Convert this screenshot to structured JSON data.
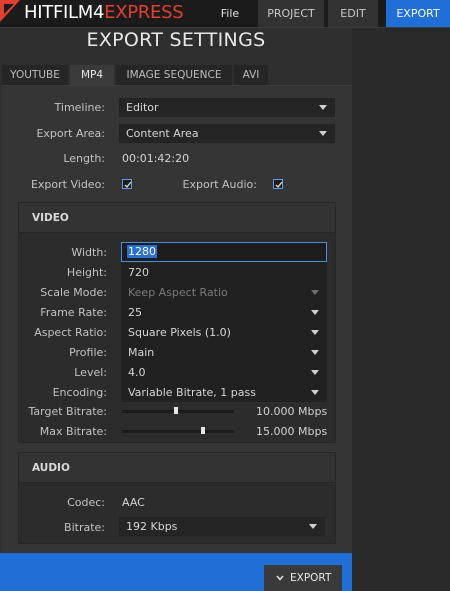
{
  "app": {
    "logo_main": "HITFILM4",
    "logo_accent": "EXPRESS",
    "brand_color": "#e0402d",
    "accent_color": "#1f6fd6"
  },
  "nav": {
    "file": "File",
    "project": "PROJECT",
    "edit": "EDIT",
    "export": "EXPORT",
    "active": "EXPORT"
  },
  "page": {
    "title": "EXPORT SETTINGS"
  },
  "tabs": [
    {
      "label": "YOUTUBE",
      "active": false
    },
    {
      "label": "MP4",
      "active": true
    },
    {
      "label": "IMAGE SEQUENCE",
      "active": false
    },
    {
      "label": "AVI",
      "active": false
    }
  ],
  "general": {
    "timeline_label": "Timeline:",
    "timeline_value": "Editor",
    "export_area_label": "Export Area:",
    "export_area_value": "Content Area",
    "length_label": "Length:",
    "length_value": "00:01:42:20",
    "export_video_label": "Export Video:",
    "export_video_checked": true,
    "export_audio_label": "Export Audio:",
    "export_audio_checked": true
  },
  "video": {
    "section_title": "VIDEO",
    "width_label": "Width:",
    "width_value": "1280",
    "height_label": "Height:",
    "height_value": "720",
    "scale_mode_label": "Scale Mode:",
    "scale_mode_value": "Keep Aspect Ratio",
    "frame_rate_label": "Frame Rate:",
    "frame_rate_value": "25",
    "aspect_ratio_label": "Aspect Ratio:",
    "aspect_ratio_value": "Square Pixels (1.0)",
    "profile_label": "Profile:",
    "profile_value": "Main",
    "level_label": "Level:",
    "level_value": "4.0",
    "encoding_label": "Encoding:",
    "encoding_value": "Variable Bitrate, 1 pass",
    "target_bitrate_label": "Target Bitrate:",
    "target_bitrate_value": "10.000",
    "target_bitrate_unit": "Mbps",
    "target_bitrate_level": 0.48,
    "max_bitrate_label": "Max Bitrate:",
    "max_bitrate_value": "15.000",
    "max_bitrate_unit": "Mbps",
    "max_bitrate_level": 0.72
  },
  "audio": {
    "section_title": "AUDIO",
    "codec_label": "Codec:",
    "codec_value": "AAC",
    "bitrate_label": "Bitrate:",
    "bitrate_value": "192 Kbps"
  },
  "footer": {
    "export_button": "EXPORT",
    "export_icon": "chevron-down-icon"
  }
}
